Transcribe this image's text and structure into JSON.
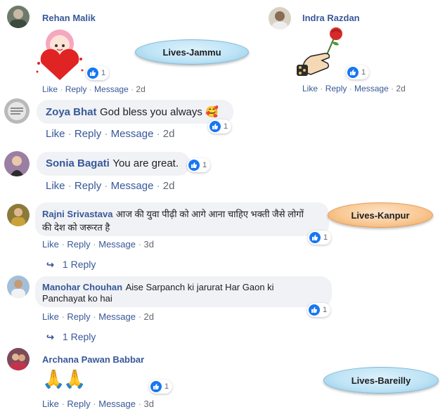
{
  "comments_top_left": {
    "author": "Rehan Malik",
    "reaction_count": "1",
    "actions": {
      "like": "Like",
      "reply": "Reply",
      "message": "Message",
      "time": "2d"
    }
  },
  "comments_top_right": {
    "author": "Indra Razdan",
    "reaction_count": "1",
    "actions": {
      "like": "Like",
      "reply": "Reply",
      "message": "Message",
      "time": "2d"
    }
  },
  "labels": {
    "jammu": "Lives-Jammu",
    "kanpur": "Lives-Kanpur",
    "bareilly": "Lives-Bareilly"
  },
  "comments": [
    {
      "author": "Zoya Bhat",
      "text": "God bless you always 🥰",
      "reaction_count": "1",
      "actions": {
        "like": "Like",
        "reply": "Reply",
        "message": "Message",
        "time": "2d"
      }
    },
    {
      "author": "Sonia Bagati",
      "text": "You are great.",
      "reaction_count": "1",
      "actions": {
        "like": "Like",
        "reply": "Reply",
        "message": "Message",
        "time": "2d"
      }
    },
    {
      "author": "Rajni Srivastava",
      "text_line1": "आज की युवा पीढ़ी को आगे आना चाहिए भक्ती जैसे लोगों",
      "text_line2": "की देश को जरूरत है",
      "reaction_count": "1",
      "actions": {
        "like": "Like",
        "reply": "Reply",
        "message": "Message",
        "time": "3d"
      },
      "replies": "1 Reply"
    },
    {
      "author": "Manohar Chouhan",
      "text_line1": "Aise Sarpanch ki jarurat Har Gaon ki",
      "text_line2": "Panchayat ko hai",
      "reaction_count": "1",
      "actions": {
        "like": "Like",
        "reply": "Reply",
        "message": "Message",
        "time": "2d"
      },
      "replies": "1 Reply"
    },
    {
      "author": "Archana Pawan Babbar",
      "emoji": "🙏🙏",
      "reaction_count": "1",
      "actions": {
        "like": "Like",
        "reply": "Reply",
        "message": "Message",
        "time": "3d"
      }
    }
  ],
  "colors": {
    "link": "#385898",
    "bubble": "#f0f2f5",
    "like_blue": "#1877f2"
  }
}
